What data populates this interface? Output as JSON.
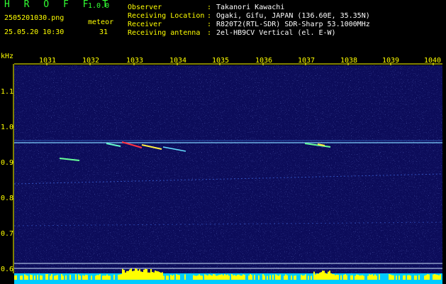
{
  "header": {
    "app_title": "H R O F F T",
    "version": "1.0.0",
    "filename": "2505201030.png",
    "datetime": "25.05.20 10:30",
    "meteor_label": "meteor",
    "meteor_count": "31"
  },
  "info": {
    "labels": [
      "Observer",
      "Receiving Location",
      "Receiver",
      "Receiving antenna"
    ],
    "values": [
      "Takanori Kawachi",
      "Ogaki, Gifu, JAPAN (136.60E, 35.35N)",
      "R820T2(RTL-SDR) SDR-Sharp 53.1000MHz",
      "2el-HB9CV Vertical (el. E-W)"
    ]
  },
  "axes": {
    "y_unit": "kHz",
    "x_ticks": [
      "1031",
      "1032",
      "1033",
      "1034",
      "1035",
      "1036",
      "1037",
      "1038",
      "1039",
      "1040"
    ],
    "y_ticks": [
      "1.1",
      "1.0",
      "0.9",
      "0.8",
      "0.7",
      "0.6"
    ]
  },
  "colors": {
    "background": "#000000",
    "spectrogram_bg": "#0c0c5a",
    "axis_text": "#ffff00",
    "info_text": "#ffffff",
    "version_text": "#33ff33",
    "signal_bar": "#00ccff",
    "signal_peak": "#ffff00"
  }
}
